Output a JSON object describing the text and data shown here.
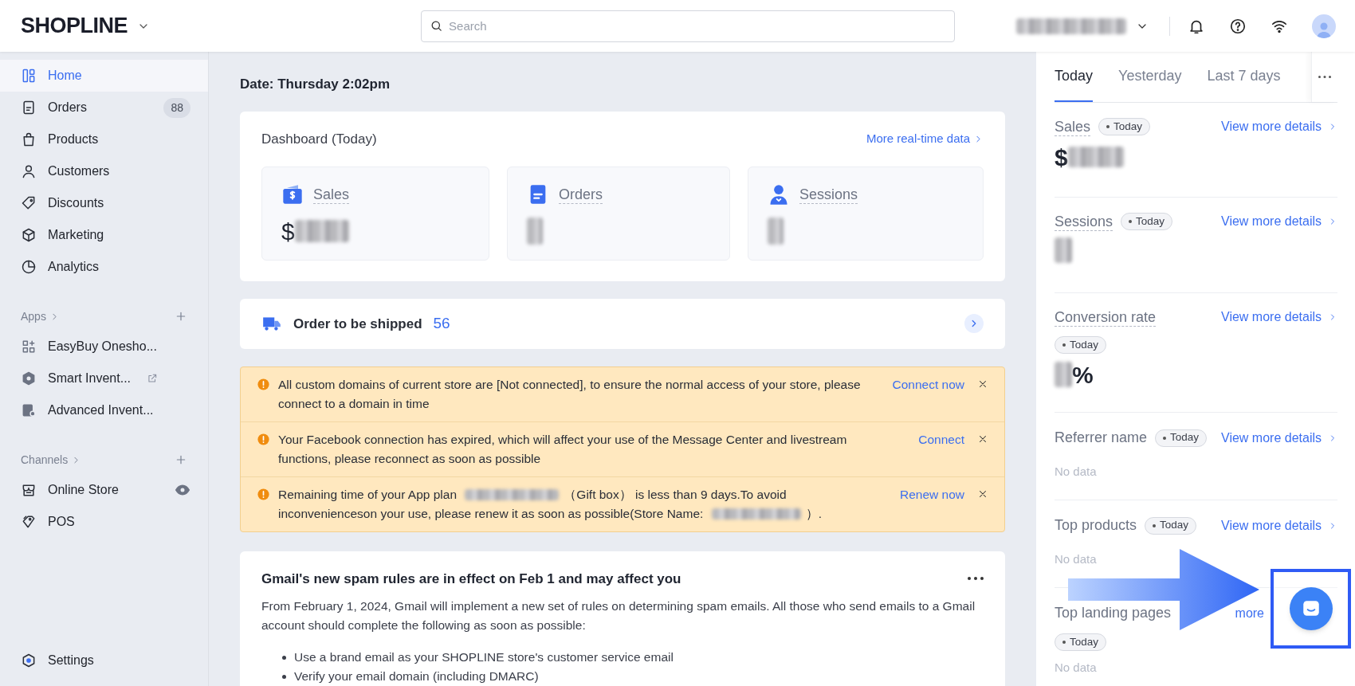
{
  "topbar": {
    "logo": "SHOPLINE",
    "search_placeholder": "Search"
  },
  "sidebar": {
    "items": [
      {
        "label": "Home",
        "selected": true
      },
      {
        "label": "Orders",
        "badge": "88",
        "selected": false
      },
      {
        "label": "Products",
        "selected": false
      },
      {
        "label": "Customers",
        "selected": false
      },
      {
        "label": "Discounts",
        "selected": false
      },
      {
        "label": "Marketing",
        "selected": false
      },
      {
        "label": "Analytics",
        "selected": false
      }
    ],
    "sections": [
      {
        "title": "Apps",
        "items": [
          {
            "label": "EasyBuy Onesho...",
            "selected": false
          },
          {
            "label": "Smart Invent...",
            "external": true,
            "selected": false
          },
          {
            "label": "Advanced Invent...",
            "selected": false
          }
        ]
      },
      {
        "title": "Channels",
        "items": [
          {
            "label": "Online Store",
            "preview": true,
            "selected": false
          },
          {
            "label": "POS",
            "selected": false
          }
        ]
      }
    ],
    "settings": {
      "label": "Settings"
    }
  },
  "main": {
    "date": "Date: Thursday 2:02pm",
    "dashboard": {
      "title": "Dashboard (Today)",
      "link": "More real-time data",
      "metrics": [
        {
          "label": "Sales",
          "prefix": "$"
        },
        {
          "label": "Orders"
        },
        {
          "label": "Sessions"
        }
      ]
    },
    "shipping": {
      "label": "Order to be shipped",
      "count": "56"
    },
    "alerts": [
      {
        "parts": [
          "All custom domains of current store are [Not connected], to ensure the normal access of your store, please connect to a domain in time"
        ],
        "action": "Connect now"
      },
      {
        "parts": [
          "Your Facebook connection has expired, which will affect your use of the Message Center and livestream functions, please reconnect as soon as possible"
        ],
        "action": "Connect"
      },
      {
        "parts": [
          "Remaining time of your App plan ",
          "（Gift box） is less than 9 days.To avoid inconvenienceson your use, please renew it as soon as possible(Store Name: ",
          "）."
        ],
        "action": "Renew now"
      }
    ],
    "notice": {
      "title": "Gmail's new spam rules are in effect on Feb 1 and may affect you",
      "body": "From February 1, 2024, Gmail will implement a new set of rules on determining spam emails. All those who send emails to a Gmail account should complete the following as soon as possible:",
      "bullets": [
        "Use a brand email as your SHOPLINE store's customer service email",
        "Verify your email domain (including DMARC)"
      ]
    }
  },
  "panel": {
    "tabs": [
      {
        "label": "Today",
        "selected": true
      },
      {
        "label": "Yesterday",
        "selected": false
      },
      {
        "label": "Last 7 days",
        "selected": false
      }
    ],
    "sections": [
      {
        "title": "Sales",
        "badge": "Today",
        "link": "View more details",
        "value": {
          "kind": "money",
          "prefix": "$"
        }
      },
      {
        "title": "Sessions",
        "badge": "Today",
        "link": "View more details",
        "value": {
          "kind": "count"
        }
      },
      {
        "title": "Conversion rate",
        "badge": "Today",
        "link": "View more details",
        "value": {
          "kind": "percent",
          "suffix": "%"
        }
      },
      {
        "title": "Referrer name",
        "badge": "Today",
        "link": "View more details",
        "empty": "No data"
      },
      {
        "title": "Top products",
        "badge": "Today",
        "link": "View more details",
        "empty": "No data"
      },
      {
        "title": "Top landing pages",
        "badge": "Today",
        "link": "more",
        "empty": "No data"
      }
    ]
  }
}
